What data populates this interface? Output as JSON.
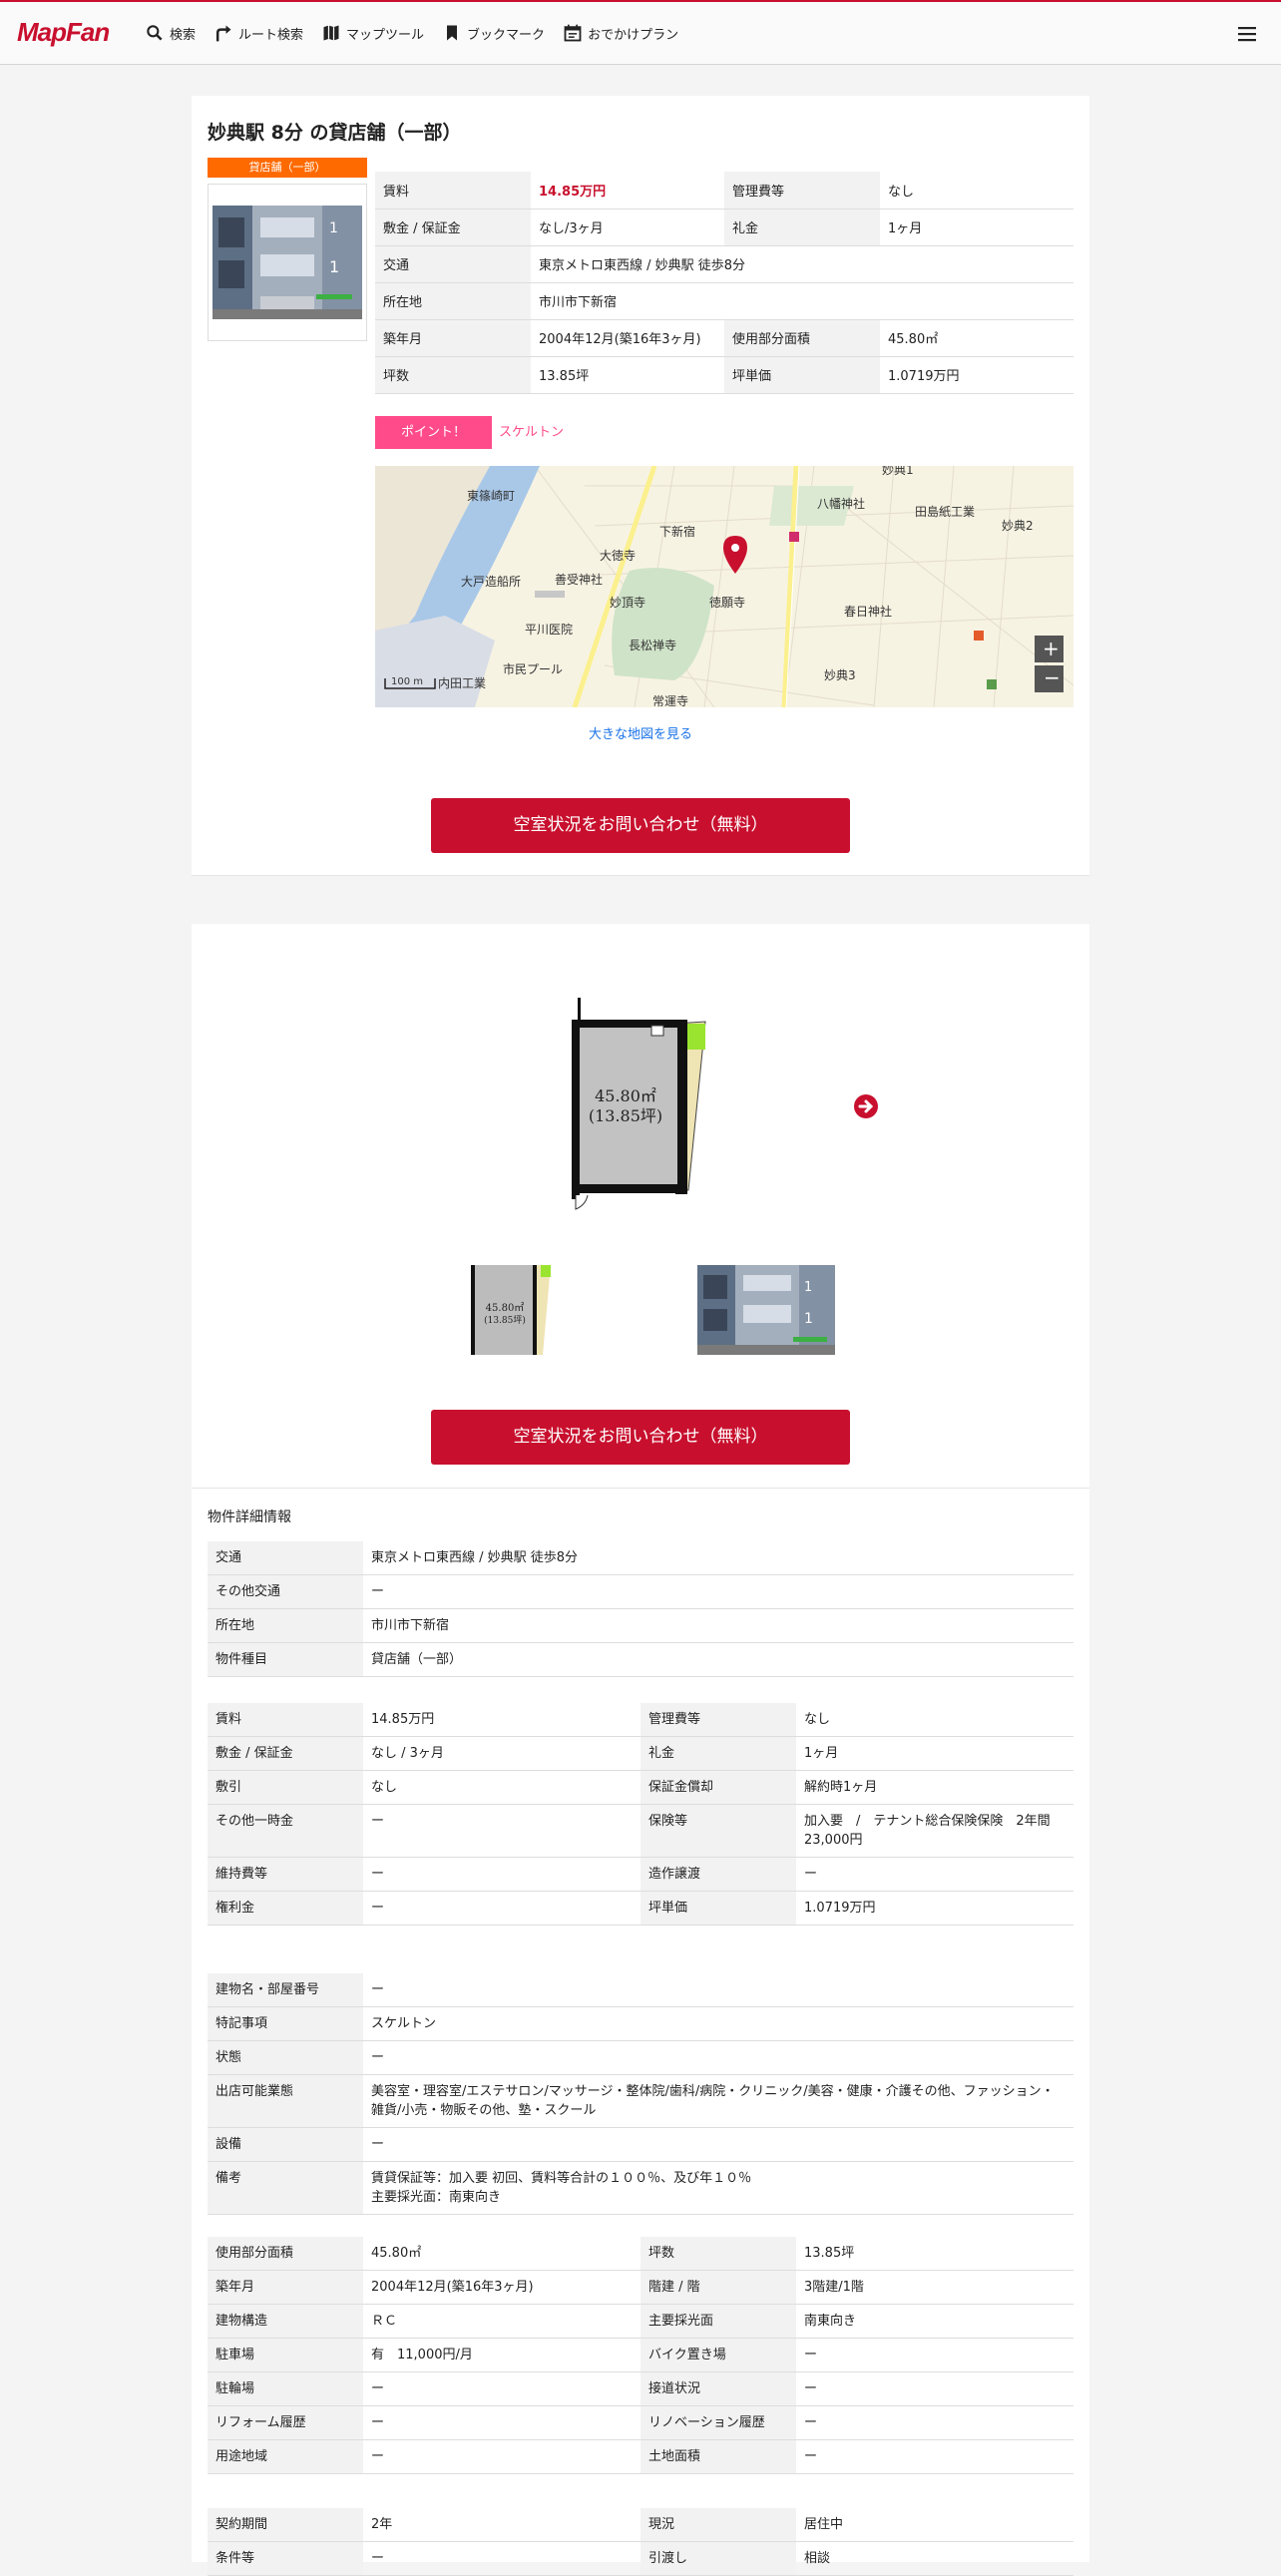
{
  "header": {
    "logo": "MapFan",
    "nav": [
      "検索",
      "ルート検索",
      "マップツール",
      "ブックマーク",
      "おでかけプラン"
    ]
  },
  "listing": {
    "title": "妙典駅 8分 の貸店舗（一部）",
    "badge": "貸店舗（一部）",
    "summary": [
      [
        {
          "k": "賃料",
          "v": "14.85万円"
        },
        {
          "k": "管理費等",
          "v": "なし"
        }
      ],
      [
        {
          "k": "敷金 / 保証金",
          "v": "なし/3ヶ月"
        },
        {
          "k": "礼金",
          "v": "1ヶ月"
        }
      ],
      [
        {
          "k": "交通",
          "v": "東京メトロ東西線 / 妙典駅 徒歩8分"
        }
      ],
      [
        {
          "k": "所在地",
          "v": "市川市下新宿"
        }
      ],
      [
        {
          "k": "築年月",
          "v": "2004年12月(築16年3ヶ月)"
        },
        {
          "k": "使用部分面積",
          "v": "45.80㎡"
        }
      ],
      [
        {
          "k": "坪数",
          "v": "13.85坪"
        },
        {
          "k": "坪単価",
          "v": "1.0719万円"
        }
      ]
    ],
    "point_label": "ポイント！",
    "point_text": "スケルトン",
    "map_link": "大きな地図を見る",
    "map_labels": [
      "東篠崎町",
      "八幡神社",
      "田島紙工業",
      "妙典2",
      "下新宿",
      "大徳寺",
      "大戸造船所",
      "善受神社",
      "妙頂寺",
      "徳願寺",
      "春日神社",
      "平川医院",
      "長松禅寺",
      "市民プール",
      "妙典3",
      "常運寺",
      "内田工業",
      "妙典1"
    ],
    "map_scale": "100 m",
    "cta": "空室状況をお問い合わせ（無料）",
    "floorplan_area": "45.80㎡",
    "floorplan_tsubo": "(13.85坪)"
  },
  "details": {
    "title": "物件詳細情報",
    "block1": [
      {
        "k": "交通",
        "v": "東京メトロ東西線 / 妙典駅 徒歩8分"
      },
      {
        "k": "その他交通",
        "v": "ー"
      },
      {
        "k": "所在地",
        "v": "市川市下新宿"
      },
      {
        "k": "物件種目",
        "v": "貸店舗（一部）"
      }
    ],
    "block2": [
      [
        {
          "k": "賃料",
          "v": "14.85万円"
        },
        {
          "k": "管理費等",
          "v": "なし"
        }
      ],
      [
        {
          "k": "敷金 / 保証金",
          "v": "なし / 3ヶ月"
        },
        {
          "k": "礼金",
          "v": "1ヶ月"
        }
      ],
      [
        {
          "k": "敷引",
          "v": "なし"
        },
        {
          "k": "保証金償却",
          "v": "解約時1ヶ月"
        }
      ],
      [
        {
          "k": "その他一時金",
          "v": "ー"
        },
        {
          "k": "保険等",
          "v": "加入要　/　テナント総合保険保険　2年間　23,000円"
        }
      ],
      [
        {
          "k": "維持費等",
          "v": "ー"
        },
        {
          "k": "造作譲渡",
          "v": "ー"
        }
      ],
      [
        {
          "k": "権利金",
          "v": "ー"
        },
        {
          "k": "坪単価",
          "v": "1.0719万円"
        }
      ]
    ],
    "block3": [
      {
        "k": "建物名・部屋番号",
        "v": "ー"
      },
      {
        "k": "特記事項",
        "v": "スケルトン"
      },
      {
        "k": "状態",
        "v": "ー"
      },
      {
        "k": "出店可能業態",
        "v": "美容室・理容室/エステサロン/マッサージ・整体院/歯科/病院・クリニック/美容・健康・介護その他、ファッション・雑貨/小売・物販その他、塾・スクール"
      },
      {
        "k": "設備",
        "v": "ー"
      },
      {
        "k": "備考",
        "v": "賃貸保証等：加入要 初回、賃料等合計の１００％、及び年１０％\n主要採光面：南東向き"
      }
    ],
    "block4": [
      [
        {
          "k": "使用部分面積",
          "v": "45.80㎡"
        },
        {
          "k": "坪数",
          "v": "13.85坪"
        }
      ],
      [
        {
          "k": "築年月",
          "v": "2004年12月(築16年3ヶ月)"
        },
        {
          "k": "階建 / 階",
          "v": "3階建/1階"
        }
      ],
      [
        {
          "k": "建物構造",
          "v": "ＲＣ"
        },
        {
          "k": "主要採光面",
          "v": "南東向き"
        }
      ],
      [
        {
          "k": "駐車場",
          "v": "有　11,000円/月"
        },
        {
          "k": "バイク置き場",
          "v": "ー"
        }
      ],
      [
        {
          "k": "駐輪場",
          "v": "ー"
        },
        {
          "k": "接道状況",
          "v": "ー"
        }
      ],
      [
        {
          "k": "リフォーム履歴",
          "v": "ー"
        },
        {
          "k": "リノベーション履歴",
          "v": "ー"
        }
      ],
      [
        {
          "k": "用途地域",
          "v": "ー"
        },
        {
          "k": "土地面積",
          "v": "ー"
        }
      ]
    ],
    "block5": [
      [
        {
          "k": "契約期間",
          "v": "2年"
        },
        {
          "k": "現況",
          "v": "居住中"
        }
      ],
      [
        {
          "k": "条件等",
          "v": "ー"
        },
        {
          "k": "引渡し",
          "v": "相談"
        }
      ]
    ]
  }
}
